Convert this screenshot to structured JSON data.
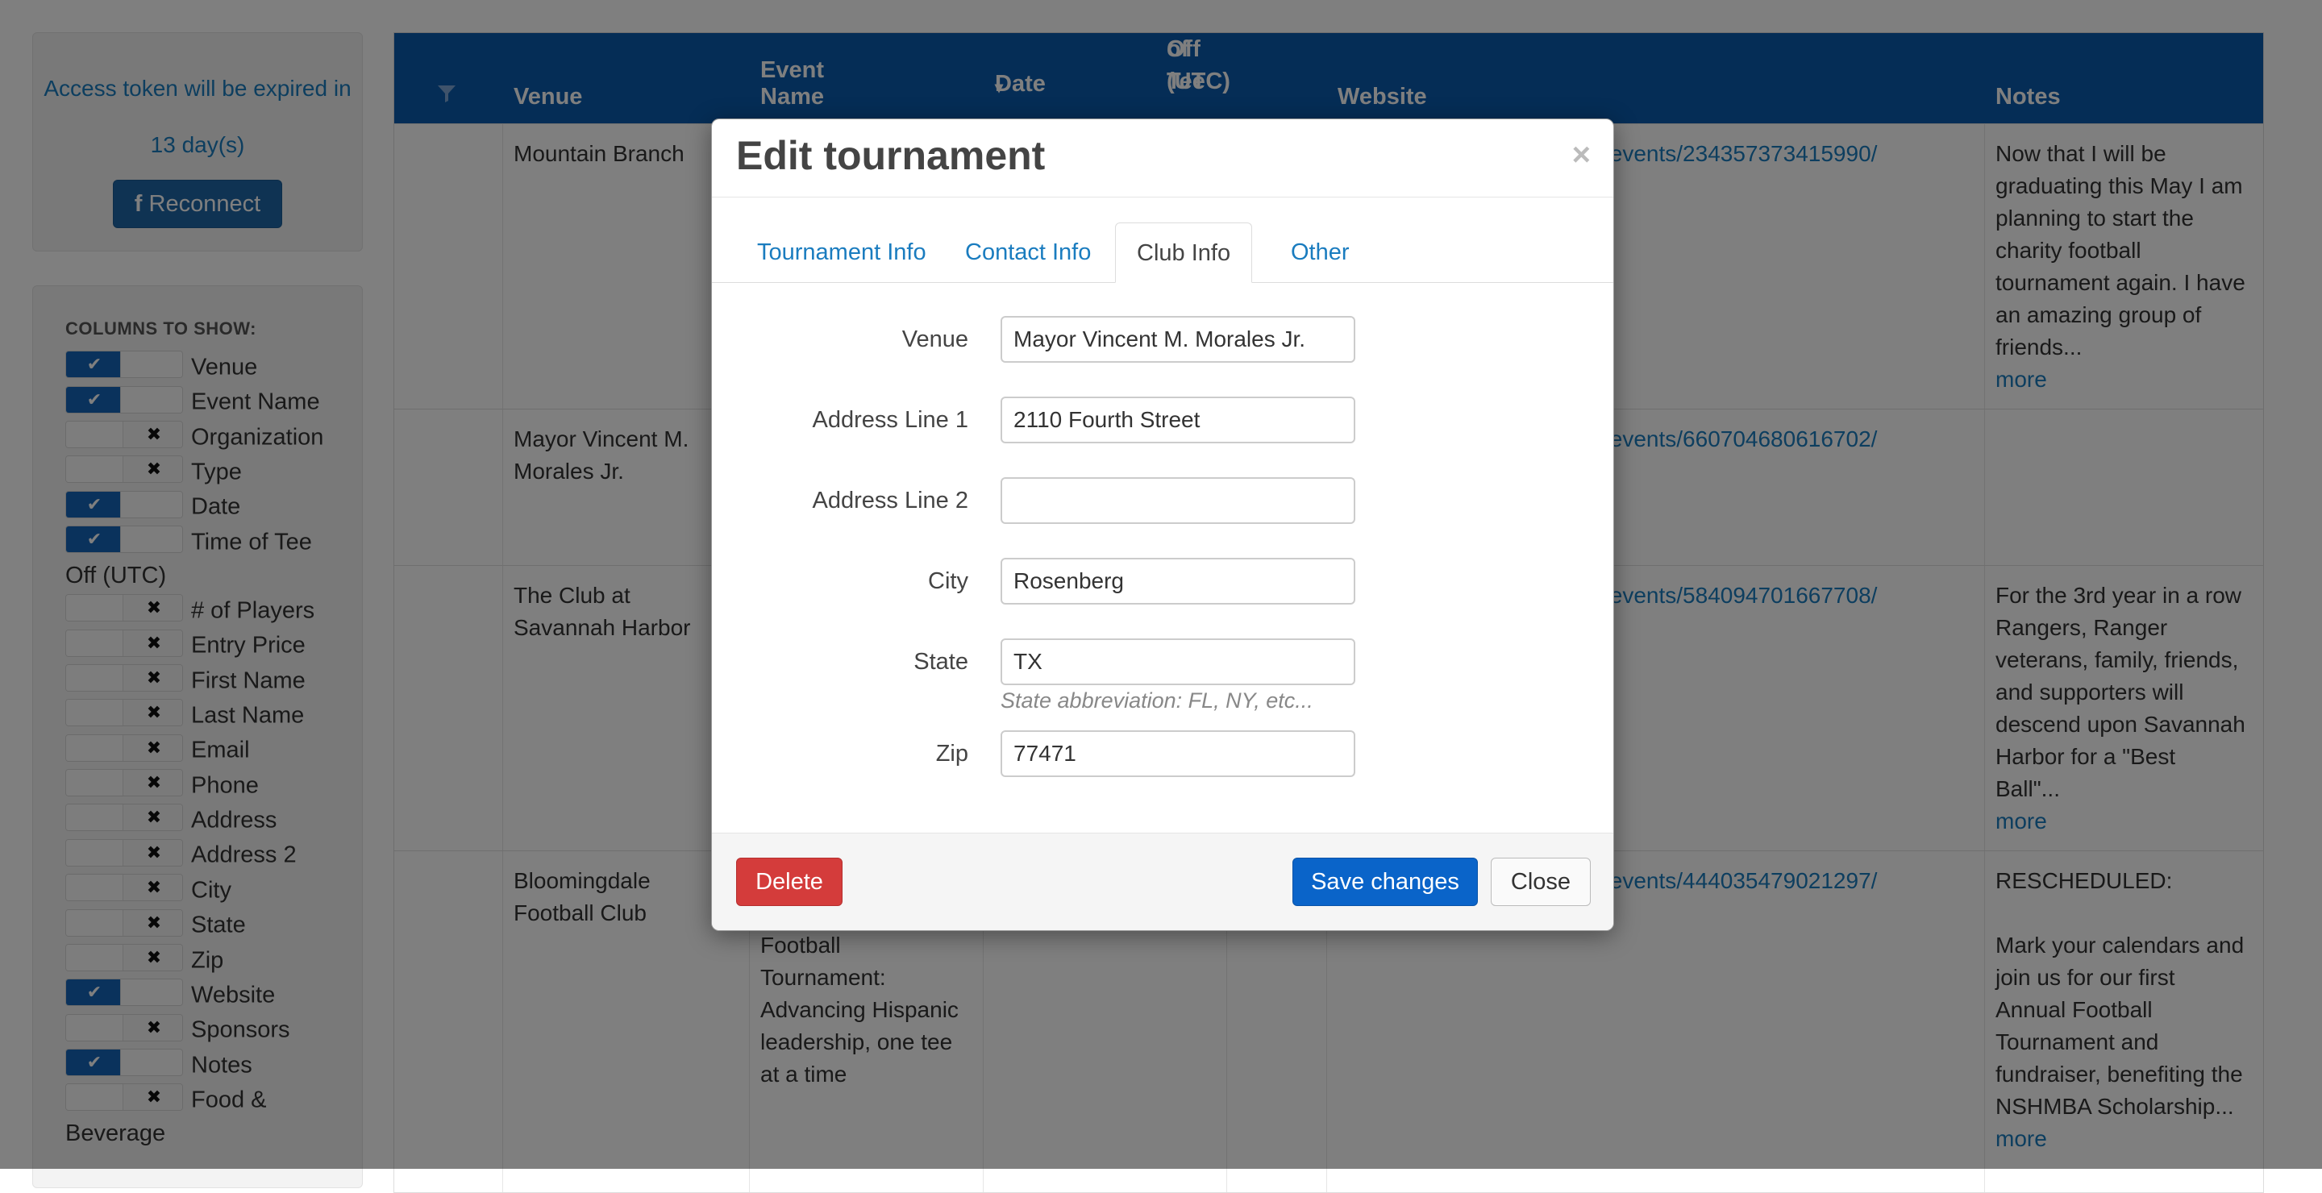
{
  "sidebar": {
    "token_text": "Access token will be expired in",
    "token_days": "13 day(s)",
    "reconnect_label": "Reconnect",
    "columns_title": "COLUMNS TO SHOW:",
    "columns": [
      {
        "label": "Venue",
        "on": true
      },
      {
        "label": "Event Name",
        "on": true
      },
      {
        "label": "Organization",
        "on": false
      },
      {
        "label": "Type",
        "on": false
      },
      {
        "label": "Date",
        "on": true
      },
      {
        "label": "Time of Tee",
        "label2": "Off (UTC)",
        "on": true
      },
      {
        "label": "# of Players",
        "on": false
      },
      {
        "label": "Entry Price",
        "on": false
      },
      {
        "label": "First Name",
        "on": false
      },
      {
        "label": "Last Name",
        "on": false
      },
      {
        "label": "Email",
        "on": false
      },
      {
        "label": "Phone",
        "on": false
      },
      {
        "label": "Address",
        "on": false
      },
      {
        "label": "Address 2",
        "on": false
      },
      {
        "label": "City",
        "on": false
      },
      {
        "label": "State",
        "on": false
      },
      {
        "label": "Zip",
        "on": false
      },
      {
        "label": "Website",
        "on": true
      },
      {
        "label": "Sponsors",
        "on": false
      },
      {
        "label": "Notes",
        "on": true
      },
      {
        "label": "Food &",
        "label2": "Beverage",
        "on": false
      }
    ]
  },
  "table": {
    "headers": {
      "filter_icon": "filter-icon",
      "venue": "Venue",
      "event_name": "Event Name",
      "date": "Date",
      "time_line1": "Time of Tee",
      "time_line2": "Off (UTC)",
      "website": "Website",
      "notes": "Notes"
    },
    "rows": [
      {
        "venue": [
          "Mountain Branch"
        ],
        "website": "/events/234357373415990/",
        "notes": [
          "Now that I will be",
          "graduating this May I am",
          "planning to start the",
          "charity football",
          "tournament again. I have",
          "an amazing group of",
          "friends..."
        ],
        "more": "more"
      },
      {
        "venue": [
          "Mayor Vincent M.",
          "Morales Jr."
        ],
        "website": "/events/660704680616702/",
        "notes": [],
        "more": ""
      },
      {
        "venue": [
          "The Club at",
          "Savannah Harbor"
        ],
        "website": "/events/584094701667708/",
        "notes": [
          "For the 3rd year in a row",
          "Rangers, Ranger",
          "veterans, family,  friends,",
          "and supporters will",
          "descend upon Savannah",
          "Harbor for a \"Best",
          "Ball\"..."
        ],
        "more": "more"
      },
      {
        "venue": [
          "Bloomingdale",
          "Football Club"
        ],
        "event_name": [
          "Football",
          "Tournament:",
          "Advancing Hispanic",
          "leadership, one tee",
          "at a time"
        ],
        "website": "/events/444035479021297/",
        "notes": [
          "RESCHEDULED:",
          "",
          "Mark your calendars and",
          "join us for our first",
          "Annual Football",
          "Tournament and",
          "fundraiser, benefiting the",
          "NSHMBA Scholarship..."
        ],
        "more": "more"
      }
    ]
  },
  "modal": {
    "title": "Edit tournament",
    "close_symbol": "×",
    "tabs": [
      {
        "label": "Tournament Info",
        "active": false
      },
      {
        "label": "Contact Info",
        "active": false
      },
      {
        "label": "Club Info",
        "active": true
      },
      {
        "label": "Other",
        "active": false
      }
    ],
    "fields": {
      "venue": {
        "label": "Venue",
        "value": "Mayor Vincent M. Morales Jr."
      },
      "address1": {
        "label": "Address Line 1",
        "value": "2110 Fourth Street"
      },
      "address2": {
        "label": "Address Line 2",
        "value": ""
      },
      "city": {
        "label": "City",
        "value": "Rosenberg"
      },
      "state": {
        "label": "State",
        "value": "TX",
        "help": "State abbreviation: FL, NY, etc..."
      },
      "zip": {
        "label": "Zip",
        "value": "77471"
      }
    },
    "buttons": {
      "delete": "Delete",
      "save": "Save changes",
      "close": "Close"
    }
  },
  "colors": {
    "header_blue": "#0a5bad",
    "link": "#1a7cbf",
    "delete_red": "#d43c3b",
    "save_blue": "#0a64c9"
  }
}
